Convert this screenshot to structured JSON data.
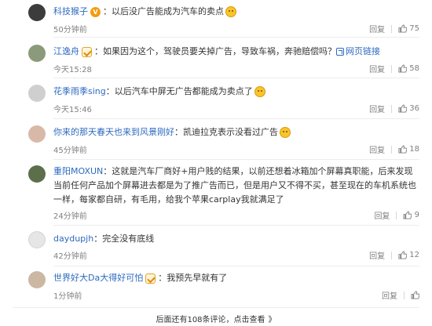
{
  "comments": [
    {
      "name": "科技猴子",
      "has_vip": true,
      "text": "：以后没广告能成为汽车的卖点",
      "emoji": true,
      "time": "50分钟前",
      "reply": "回复",
      "likes": "75",
      "avatar_color": "#3c3c3c"
    },
    {
      "name": "江逸舟",
      "has_badge": true,
      "text": "：如果因为这个，驾驶员要关掉广告，导致车祸，奔驰赔偿吗？",
      "link_text": "网页链接",
      "time": "今天15:28",
      "reply": "回复",
      "likes": "58",
      "avatar_color": "#8a9a7a"
    },
    {
      "name": "花季雨季sing",
      "text": "：以后汽车中屏无广告都能成为卖点了",
      "emoji": true,
      "time": "今天15:46",
      "reply": "回复",
      "likes": "36",
      "avatar_color": "#cfcfcf"
    },
    {
      "name": "你来的那天春天也来到风景刚好",
      "text": "：凯迪拉克表示没看过广告",
      "emoji": true,
      "time": "45分钟前",
      "reply": "回复",
      "likes": "18",
      "avatar_color": "#d8b9a8"
    },
    {
      "name": "重阳MOXUN",
      "text": "：这就是汽车厂商好+用户贱的结果，以前还想着冰箱加个屏幕真职能，后来发现当前任何产品加个屏幕进去都是为了推广告而已，但是用户又不得不买，甚至现在的车机系统也一样，每家都自研，有毛用，给我个苹果carplay我就满足了",
      "time": "24分钟前",
      "reply": "回复",
      "likes": "9",
      "avatar_color": "#5d6e4a"
    },
    {
      "name": "daydupjh",
      "text": "：完全没有底线",
      "time": "42分钟前",
      "reply": "回复",
      "likes": "12",
      "avatar_color": "#e6e6e6"
    },
    {
      "name": "世界好大Da大得好可怕",
      "has_badge": true,
      "text": "：我预先早就有了",
      "time": "1分钟前",
      "reply": "回复",
      "likes": "",
      "avatar_color": "#cbb7a2"
    }
  ],
  "more_link": "后面还有108条评论，点击查看",
  "more_arrow": "》"
}
